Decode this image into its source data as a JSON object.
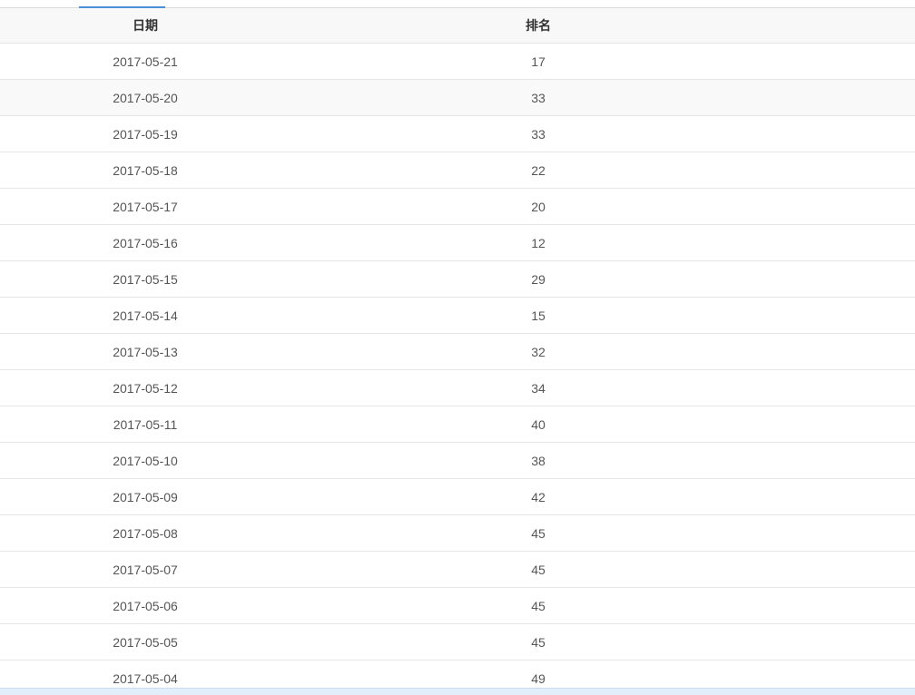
{
  "table": {
    "headers": {
      "date": "日期",
      "rank": "排名"
    },
    "rows": [
      {
        "date": "2017-05-21",
        "rank": "17"
      },
      {
        "date": "2017-05-20",
        "rank": "33"
      },
      {
        "date": "2017-05-19",
        "rank": "33"
      },
      {
        "date": "2017-05-18",
        "rank": "22"
      },
      {
        "date": "2017-05-17",
        "rank": "20"
      },
      {
        "date": "2017-05-16",
        "rank": "12"
      },
      {
        "date": "2017-05-15",
        "rank": "29"
      },
      {
        "date": "2017-05-14",
        "rank": "15"
      },
      {
        "date": "2017-05-13",
        "rank": "32"
      },
      {
        "date": "2017-05-12",
        "rank": "34"
      },
      {
        "date": "2017-05-11",
        "rank": "40"
      },
      {
        "date": "2017-05-10",
        "rank": "38"
      },
      {
        "date": "2017-05-09",
        "rank": "42"
      },
      {
        "date": "2017-05-08",
        "rank": "45"
      },
      {
        "date": "2017-05-07",
        "rank": "45"
      },
      {
        "date": "2017-05-06",
        "rank": "45"
      },
      {
        "date": "2017-05-05",
        "rank": "45"
      },
      {
        "date": "2017-05-04",
        "rank": "49"
      }
    ]
  },
  "colors": {
    "accent": "#4a90d9",
    "header_bg": "#f8f8f8",
    "text": "#555555",
    "border": "#e6e6e6"
  }
}
